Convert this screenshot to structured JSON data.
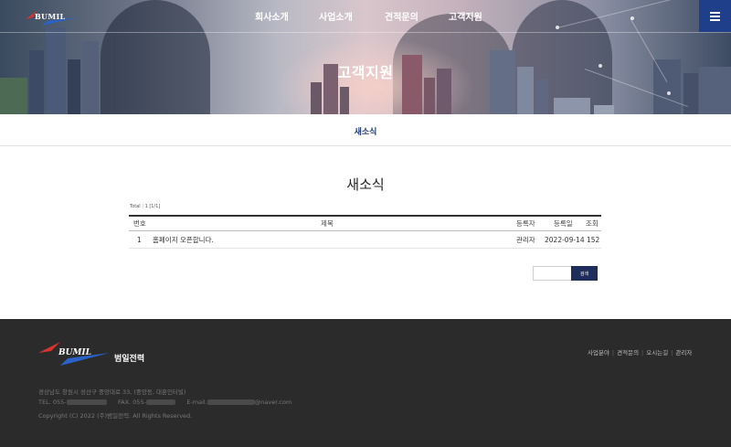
{
  "header": {
    "logo_text": "BUMIL",
    "nav": [
      {
        "label": "회사소개"
      },
      {
        "label": "사업소개"
      },
      {
        "label": "견적문의"
      },
      {
        "label": "고객지원"
      }
    ],
    "menu_icon": "hamburger-icon"
  },
  "hero": {
    "title": "고객지원"
  },
  "subnav": {
    "active_tab": "새소식"
  },
  "board": {
    "title": "새소식",
    "total_label": "Total",
    "total_count": "1",
    "total_pages": "[1/1]",
    "columns": {
      "no": "번호",
      "title": "제목",
      "author": "등록자",
      "date": "등록일",
      "views": "조회"
    },
    "rows": [
      {
        "no": "1",
        "title": "홈페이지 오픈합니다.",
        "author": "관리자",
        "date": "2022-09-14",
        "views": "152"
      }
    ],
    "search": {
      "input_value": "",
      "button_label": "검색"
    }
  },
  "footer": {
    "logo_text": "BUMIL",
    "company_name": "범일전력",
    "links": [
      "사업분야",
      "견적문의",
      "오시는길",
      "관리자"
    ],
    "address": "경상남도 창원시 성산구 중앙대로 33, (중앙동, 대훈인터빌)",
    "tel_label": "TEL. 055-",
    "fax_label": "FAX. 055-",
    "email_label": "E-mail.",
    "email_domain": "@naver.com",
    "copyright": "Copyright (C) 2022 (주)범일전력. All Rights Reserved."
  },
  "colors": {
    "accent": "#1f3f8a",
    "button": "#1f2d5c",
    "footer_bg": "#2b2b2b",
    "logo_red": "#d8342f",
    "logo_blue": "#2a62c9"
  }
}
